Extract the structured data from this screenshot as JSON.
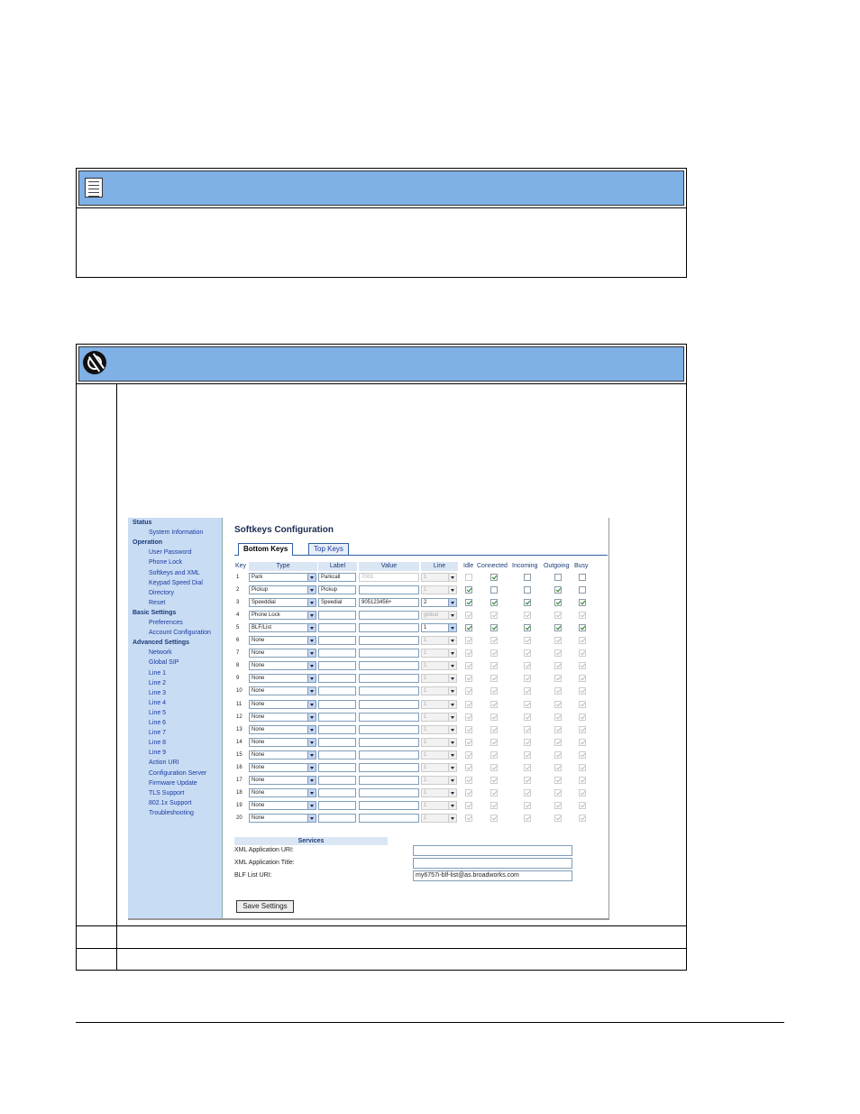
{
  "softkeys": {
    "title": "Softkeys Configuration",
    "tabs": [
      {
        "label": "Bottom Keys",
        "active": true
      },
      {
        "label": "Top Keys",
        "active": false
      }
    ],
    "columns": [
      "Key",
      "Type",
      "Label",
      "Value",
      "Line",
      "Idle",
      "Connected",
      "Incoming",
      "Outgoing",
      "Busy"
    ],
    "rows": [
      {
        "key": "1",
        "type": "Park",
        "label": "Parkcall",
        "value": "7001",
        "line": "1",
        "states": [
          false,
          true,
          false,
          false,
          false
        ],
        "active": true,
        "line_disabled": true,
        "value_disabled": true,
        "idle_disabled": true
      },
      {
        "key": "2",
        "type": "Pickup",
        "label": "Pickup",
        "value": "",
        "line": "1",
        "states": [
          true,
          false,
          false,
          true,
          false
        ],
        "active": true,
        "line_disabled": true
      },
      {
        "key": "3",
        "type": "Speeddial",
        "label": "Speedial",
        "value": "905123456+",
        "line": "2",
        "states": [
          true,
          true,
          true,
          true,
          true
        ],
        "active": true
      },
      {
        "key": "4",
        "type": "Phone Lock",
        "label": "",
        "value": "",
        "line": "global",
        "states": [
          true,
          true,
          true,
          true,
          true
        ],
        "dim": true,
        "line_disabled": true
      },
      {
        "key": "5",
        "type": "BLF/List",
        "label": "",
        "value": "",
        "line": "1",
        "states": [
          true,
          true,
          true,
          true,
          true
        ],
        "active": true
      },
      {
        "key": "6",
        "type": "None",
        "label": "",
        "value": "",
        "line": "1",
        "dim": true
      },
      {
        "key": "7",
        "type": "None",
        "label": "",
        "value": "",
        "line": "1",
        "dim": true
      },
      {
        "key": "8",
        "type": "None",
        "label": "",
        "value": "",
        "line": "1",
        "dim": true
      },
      {
        "key": "9",
        "type": "None",
        "label": "",
        "value": "",
        "line": "1",
        "dim": true
      },
      {
        "key": "10",
        "type": "None",
        "label": "",
        "value": "",
        "line": "1",
        "dim": true
      },
      {
        "key": "11",
        "type": "None",
        "label": "",
        "value": "",
        "line": "1",
        "dim": true
      },
      {
        "key": "12",
        "type": "None",
        "label": "",
        "value": "",
        "line": "1",
        "dim": true
      },
      {
        "key": "13",
        "type": "None",
        "label": "",
        "value": "",
        "line": "1",
        "dim": true
      },
      {
        "key": "14",
        "type": "None",
        "label": "",
        "value": "",
        "line": "1",
        "dim": true
      },
      {
        "key": "15",
        "type": "None",
        "label": "",
        "value": "",
        "line": "1",
        "dim": true
      },
      {
        "key": "16",
        "type": "None",
        "label": "",
        "value": "",
        "line": "1",
        "dim": true
      },
      {
        "key": "17",
        "type": "None",
        "label": "",
        "value": "",
        "line": "1",
        "dim": true
      },
      {
        "key": "18",
        "type": "None",
        "label": "",
        "value": "",
        "line": "1",
        "dim": true
      },
      {
        "key": "19",
        "type": "None",
        "label": "",
        "value": "",
        "line": "1",
        "dim": true
      },
      {
        "key": "20",
        "type": "None",
        "label": "",
        "value": "",
        "line": "1",
        "dim": true
      }
    ],
    "services": {
      "header": "Services",
      "xml_uri_label": "XML Application URI:",
      "xml_uri_value": "",
      "xml_title_label": "XML Application Title:",
      "xml_title_value": "",
      "blf_uri_label": "BLF List URI:",
      "blf_uri_value": "my6757i-blf-list@as.broadworks.com"
    },
    "save_label": "Save Settings"
  },
  "sidebar": [
    {
      "label": "Status",
      "group": true
    },
    {
      "label": "System Information"
    },
    {
      "label": "Operation",
      "group": true
    },
    {
      "label": "User Password"
    },
    {
      "label": "Phone Lock"
    },
    {
      "label": "Softkeys and XML"
    },
    {
      "label": "Keypad Speed Dial"
    },
    {
      "label": "Directory"
    },
    {
      "label": "Reset"
    },
    {
      "label": "Basic Settings",
      "group": true
    },
    {
      "label": "Preferences"
    },
    {
      "label": "Account Configuration"
    },
    {
      "label": "Advanced Settings",
      "group": true
    },
    {
      "label": "Network"
    },
    {
      "label": "Global SIP"
    },
    {
      "label": "Line 1"
    },
    {
      "label": "Line 2"
    },
    {
      "label": "Line 3"
    },
    {
      "label": "Line 4"
    },
    {
      "label": "Line 5"
    },
    {
      "label": "Line 6"
    },
    {
      "label": "Line 7"
    },
    {
      "label": "Line 8"
    },
    {
      "label": "Line 9"
    },
    {
      "label": "Action URI"
    },
    {
      "label": "Configuration Server"
    },
    {
      "label": "Firmware Update"
    },
    {
      "label": "TLS Support"
    },
    {
      "label": "802.1x Support"
    },
    {
      "label": "Troubleshooting"
    }
  ],
  "icons": {
    "note": "note-icon",
    "web": "globe-icon"
  },
  "colors": {
    "header_blue": "#7fb0e6",
    "sidebar_blue": "#c8dcf4"
  }
}
